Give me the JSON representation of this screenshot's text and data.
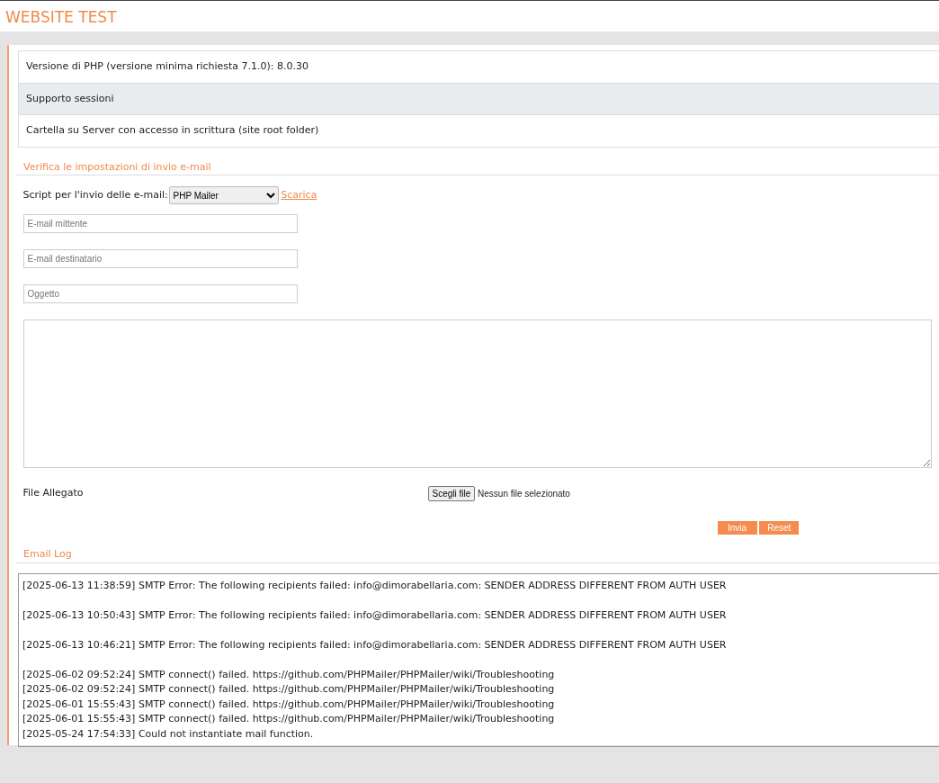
{
  "header": {
    "title": "WEBSITE TEST"
  },
  "checks": [
    {
      "label": "Versione di PHP (versione minima richiesta 7.1.0): 8.0.30",
      "highlighted": false
    },
    {
      "label": "Supporto sessioni",
      "highlighted": true
    },
    {
      "label": "Cartella su Server con accesso in scrittura (site root folder)",
      "highlighted": false
    }
  ],
  "email_test": {
    "heading": "Verifica le impostazioni di invio e-mail",
    "script_label": "Script per l'invio delle e-mail:",
    "script_value": "PHP Mailer",
    "download_link": "Scarica",
    "fields": [
      {
        "placeholder": "E-mail mittente"
      },
      {
        "placeholder": "E-mail destinatario"
      },
      {
        "placeholder": "Oggetto"
      }
    ],
    "attachment_label": "File Allegato",
    "file_button": "Scegli file",
    "file_status": "Nessun file selezionato",
    "buttons": [
      "Invia",
      "Reset"
    ]
  },
  "email_log": {
    "heading": "Email Log",
    "lines": [
      {
        "text": "[2025-06-13 11:38:59] SMTP Error: The following recipients failed: info@dimorabellaria.com: SENDER ADDRESS DIFFERENT FROM AUTH USER",
        "spaced": true
      },
      {
        "text": "[2025-06-13 10:50:43] SMTP Error: The following recipients failed: info@dimorabellaria.com: SENDER ADDRESS DIFFERENT FROM AUTH USER",
        "spaced": true
      },
      {
        "text": "[2025-06-13 10:46:21] SMTP Error: The following recipients failed: info@dimorabellaria.com: SENDER ADDRESS DIFFERENT FROM AUTH USER",
        "spaced": true
      },
      {
        "text": "[2025-06-02 09:52:24] SMTP connect() failed. https://github.com/PHPMailer/PHPMailer/wiki/Troubleshooting",
        "spaced": false
      },
      {
        "text": "[2025-06-02 09:52:24] SMTP connect() failed. https://github.com/PHPMailer/PHPMailer/wiki/Troubleshooting",
        "spaced": false
      },
      {
        "text": "[2025-06-01 15:55:43] SMTP connect() failed. https://github.com/PHPMailer/PHPMailer/wiki/Troubleshooting",
        "spaced": false
      },
      {
        "text": "[2025-06-01 15:55:43] SMTP connect() failed. https://github.com/PHPMailer/PHPMailer/wiki/Troubleshooting",
        "spaced": false
      },
      {
        "text": "[2025-05-24 17:54:33] Could not instantiate mail function.",
        "spaced": false
      }
    ]
  }
}
